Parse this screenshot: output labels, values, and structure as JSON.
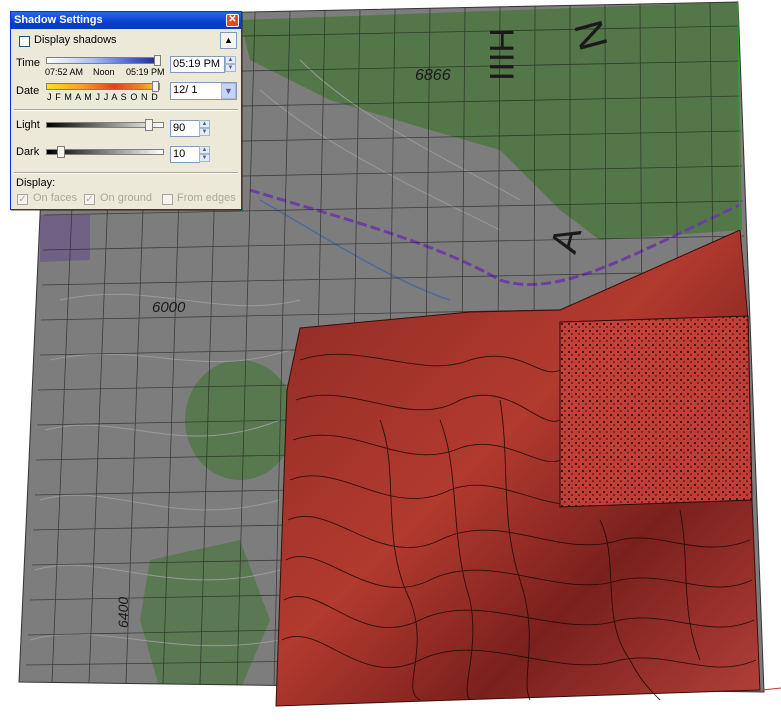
{
  "map_labels": {
    "elevation_top": "6866",
    "elevation_mid": "6000",
    "elevation_left": "6400",
    "letters_left": "HIII",
    "letter_n": "N",
    "letter_a": "A"
  },
  "dialog": {
    "title": "Shadow Settings",
    "close_glyph": "✕",
    "collapse_glyph": "▲",
    "display_shadows_label": "Display shadows",
    "time": {
      "label": "Time",
      "start": "07:52 AM",
      "noon": "Noon",
      "end": "05:19 PM",
      "value": "05:19 PM"
    },
    "date": {
      "label": "Date",
      "months": "J F M A M J J A S O N D",
      "value": "12/ 1"
    },
    "light": {
      "label": "Light",
      "value": "90",
      "level": 0.9
    },
    "dark": {
      "label": "Dark",
      "value": "10",
      "level": 0.1
    },
    "display_label": "Display:",
    "on_faces_label": "On faces",
    "on_ground_label": "On ground",
    "from_edges_label": "From edges",
    "check_glyph": "✓"
  },
  "colors": {
    "terrain": "#b23a2f",
    "map_gray": "#7d7d7d",
    "forest_green": "#4f7744",
    "titlebar": "#0a3fd0"
  }
}
